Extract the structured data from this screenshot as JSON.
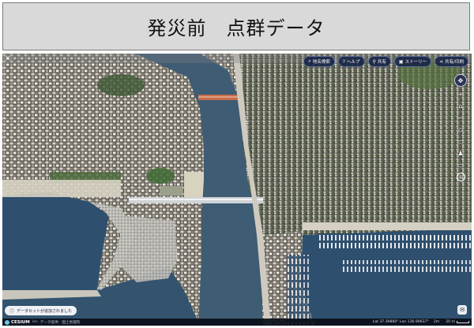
{
  "title": "発災前　点群データ",
  "toolbar": {
    "buttons": [
      {
        "icon": "search-icon",
        "label": "地名検索"
      },
      {
        "icon": "help-icon",
        "label": "ヘルプ"
      },
      {
        "icon": "share-link-icon",
        "label": "共有"
      },
      {
        "icon": "story-icon",
        "label": "ストーリー"
      },
      {
        "icon": "share-icon",
        "label": "共有/印刷"
      }
    ]
  },
  "notice": {
    "icon": "info-icon",
    "text": "データセットが追加されました"
  },
  "statusbar": {
    "brand": "CESIUM",
    "ion": "ion",
    "attribution": "データ提供：国土地理院",
    "coordinates": "Lat 37.39880°  Lon 136.90637°",
    "height": "2m",
    "scale": "20 m"
  },
  "colors": {
    "sea": "#2f4f6e",
    "river": "#3e5c73",
    "toolbar": "#16224a",
    "header": "#d9d9d9"
  }
}
